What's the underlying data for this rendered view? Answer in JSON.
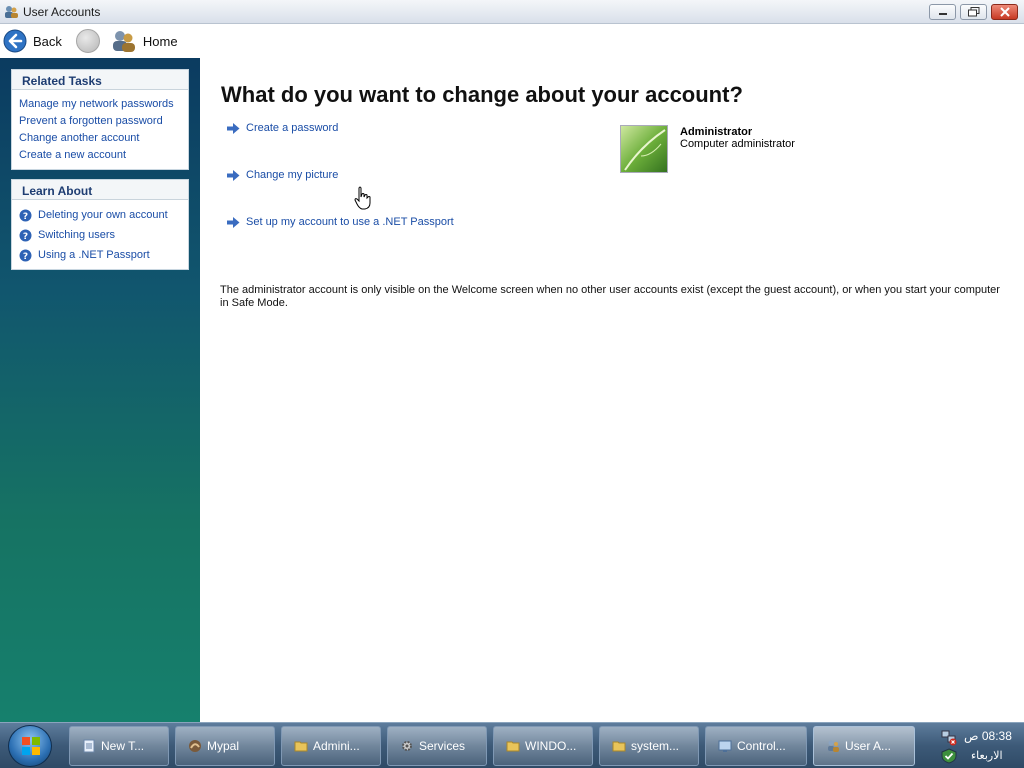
{
  "window": {
    "title": "User Accounts"
  },
  "toolbar": {
    "back_label": "Back",
    "home_label": "Home"
  },
  "sidebar": {
    "related_tasks": {
      "title": "Related Tasks",
      "links": [
        "Manage my network passwords",
        "Prevent a forgotten password",
        "Change another account",
        "Create a new account"
      ]
    },
    "learn_about": {
      "title": "Learn About",
      "links": [
        "Deleting your own account",
        "Switching users",
        "Using a .NET Passport"
      ]
    }
  },
  "main": {
    "heading": "What do you want to change about your account?",
    "actions": [
      "Create a password",
      "Change my picture",
      "Set up my account to use a .NET Passport"
    ],
    "account": {
      "name": "Administrator",
      "role": "Computer administrator"
    },
    "note": "The administrator account is only visible on the Welcome screen when no other user accounts exist (except the guest account), or when you start your computer in Safe Mode."
  },
  "taskbar": {
    "buttons": [
      "New T...",
      "Mypal",
      "Admini...",
      "Services",
      "WINDO...",
      "system...",
      "Control...",
      "User A..."
    ],
    "clock_time": "08:38 ص",
    "clock_day": "الاربعاء"
  },
  "colors": {
    "link": "#1a4da6",
    "sidebar_top": "#0b3b60",
    "sidebar_bottom": "#16806d"
  }
}
